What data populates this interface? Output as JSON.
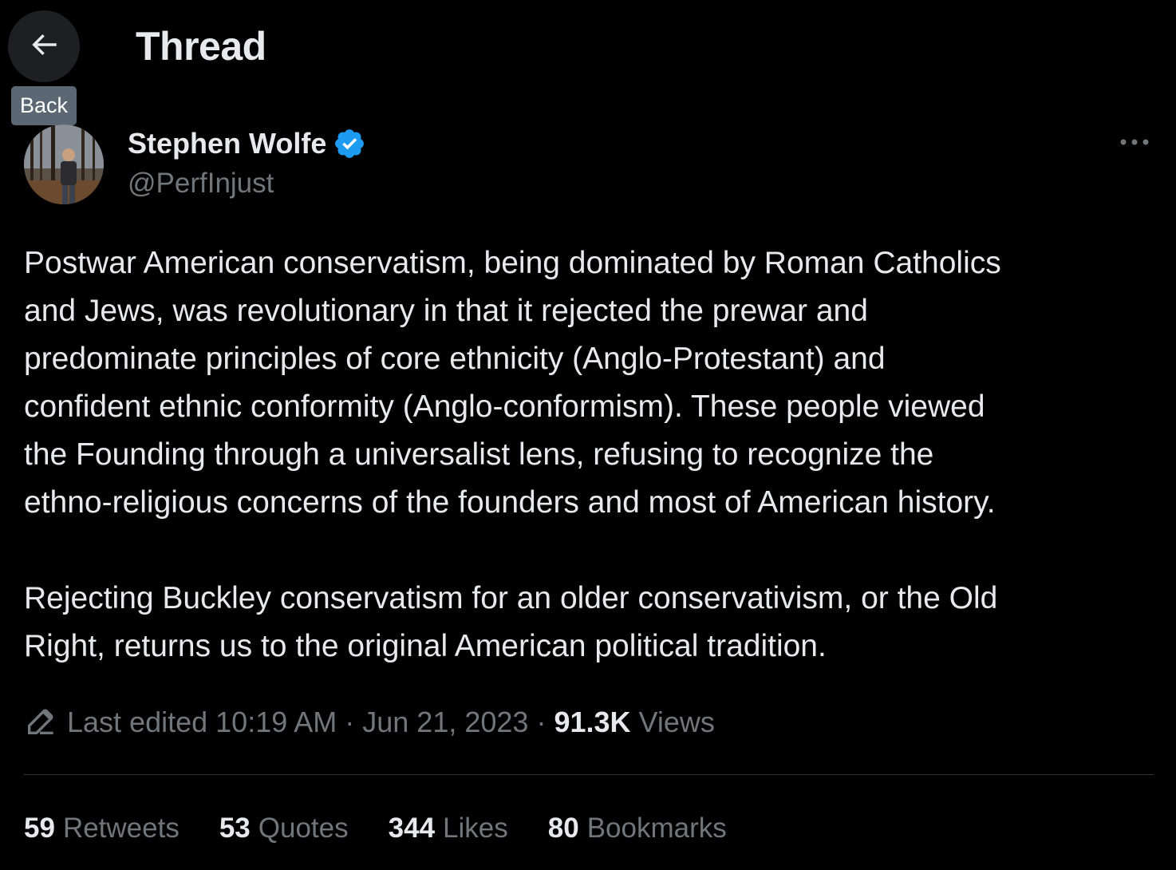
{
  "header": {
    "title": "Thread",
    "back_tooltip": "Back"
  },
  "tweet": {
    "author_name": "Stephen Wolfe",
    "author_handle": "@PerfInjust",
    "paragraphs": [
      "Postwar American conservatism, being dominated by Roman Catholics\nand Jews, was revolutionary in that it rejected the prewar and\npredominate principles of core ethnicity (Anglo-Protestant) and\nconfident ethnic conformity (Anglo-conformism). These people viewed\nthe Founding through a universalist lens, refusing to recognize the\nethno-religious concerns of the founders and most of American history.",
      "Rejecting Buckley conservatism for an older conservativism, or the Old\nRight, returns us to the original American political tradition."
    ],
    "edited_label": "Last edited",
    "time": "10:19 AM",
    "date": "Jun 21, 2023",
    "separator": "·",
    "views_count": "91.3K",
    "views_label": "Views"
  },
  "stats": [
    {
      "count": "59",
      "label": "Retweets"
    },
    {
      "count": "53",
      "label": "Quotes"
    },
    {
      "count": "344",
      "label": "Likes"
    },
    {
      "count": "80",
      "label": "Bookmarks"
    }
  ],
  "icons": {
    "back": "arrow-left-icon",
    "verified": "verified-badge-icon",
    "more": "more-horizontal-icon",
    "edit": "pencil-edit-icon"
  },
  "colors": {
    "background": "#000000",
    "text_primary": "#e7e9ea",
    "text_secondary": "#71767b",
    "verified_blue": "#1d9bf0",
    "tooltip_bg": "#5b6873"
  }
}
